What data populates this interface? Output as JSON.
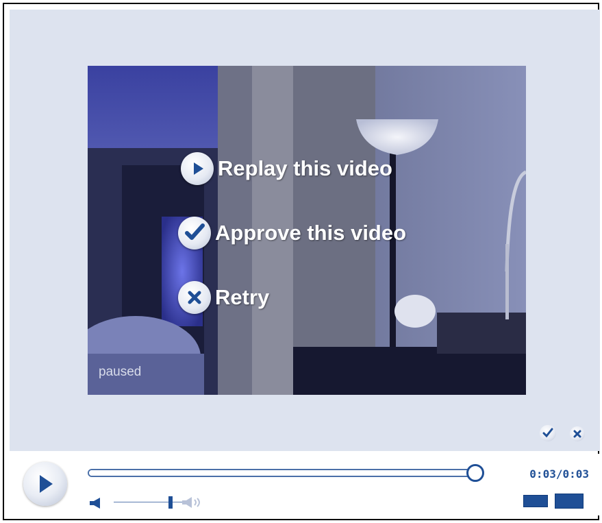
{
  "overlay": {
    "replay_label": "Replay this video",
    "approve_label": "Approve this video",
    "retry_label": "Retry"
  },
  "video": {
    "status_text": "paused"
  },
  "player": {
    "time_display": "0:03/0:03",
    "progress": 1.0,
    "volume": 0.77
  },
  "icons": {
    "replay": "play-icon",
    "approve": "checkmark-icon",
    "retry": "x-icon",
    "mini_approve": "checkmark-icon",
    "mini_retry": "x-icon",
    "play": "play-icon",
    "volume_low": "speaker-icon",
    "volume_high": "speaker-loud-icon",
    "normal_size": "rectangle-small-icon",
    "full_size": "rectangle-large-icon"
  },
  "colors": {
    "accent": "#1f4f96",
    "stage_background": "#dde3ef"
  }
}
